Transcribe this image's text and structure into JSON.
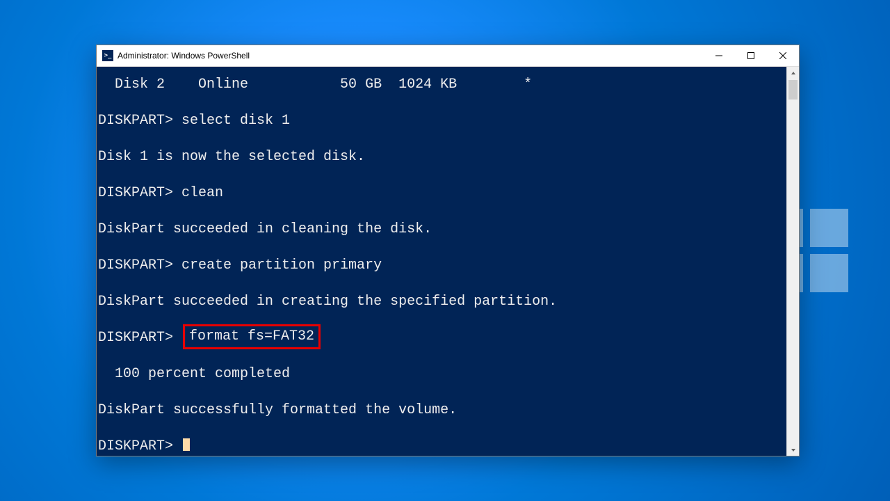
{
  "window": {
    "title": "Administrator: Windows PowerShell",
    "icon_text": ">_"
  },
  "terminal": {
    "lines": [
      "  Disk 2    Online           50 GB  1024 KB        *",
      "DISKPART> select disk 1",
      "Disk 1 is now the selected disk.",
      "DISKPART> clean",
      "DiskPart succeeded in cleaning the disk.",
      "DISKPART> create partition primary",
      "DiskPart succeeded in creating the specified partition.",
      "  100 percent completed",
      "DiskPart successfully formatted the volume."
    ],
    "highlighted_prompt": "DISKPART> ",
    "highlighted_command": "format fs=FAT32",
    "final_prompt": "DISKPART> "
  }
}
